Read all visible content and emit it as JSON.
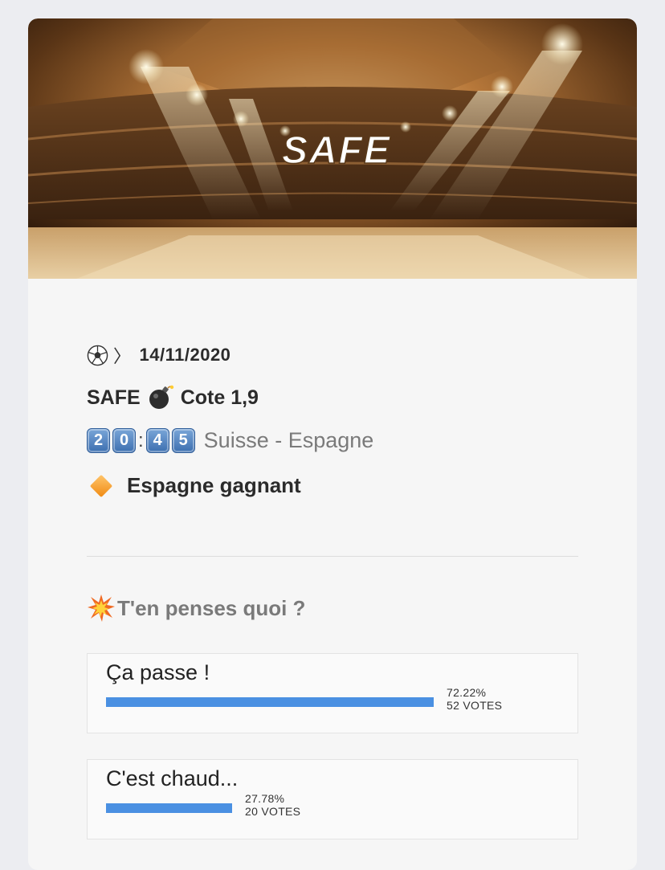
{
  "banner": {
    "title": "SAFE"
  },
  "post": {
    "date_icon": "soccer-ball-icon",
    "date_sep": "〉",
    "date": "14/11/2020",
    "title_left": "SAFE",
    "title_icon": "bomb-icon",
    "title_right": "Cote 1,9",
    "time_digits": [
      "2",
      "0",
      "4",
      "5"
    ],
    "time_sep": ":",
    "teams": "Suisse - Espagne",
    "pick_icon": "orange-diamond-icon",
    "pick": "Espagne gagnant"
  },
  "poll": {
    "question_icon": "collision-icon",
    "question": "T'en penses quoi ?",
    "options": [
      {
        "label": "Ça passe !",
        "percent_text": "72.22%",
        "votes_text": "52 VOTES",
        "fraction": 0.7222
      },
      {
        "label": "C'est chaud...",
        "percent_text": "27.78%",
        "votes_text": "20 VOTES",
        "fraction": 0.2778
      }
    ]
  },
  "colors": {
    "accent_bar": "#4a90e2",
    "card_bg": "#f6f6f6",
    "page_bg": "#ecedf1"
  }
}
